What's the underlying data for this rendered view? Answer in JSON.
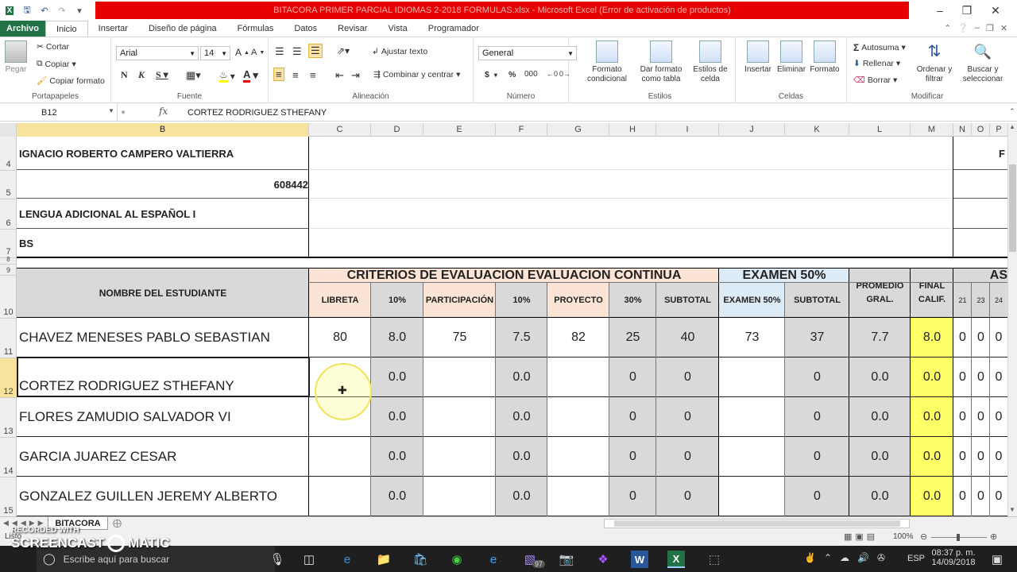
{
  "window": {
    "title": "BITACORA PRIMER PARCIAL IDIOMAS 2-2018 FORMULAS.xlsx - Microsoft Excel (Error de activación de productos)"
  },
  "tabs": [
    "Archivo",
    "Inicio",
    "Insertar",
    "Diseño de página",
    "Fórmulas",
    "Datos",
    "Revisar",
    "Vista",
    "Programador"
  ],
  "ribbon": {
    "clipboard": {
      "paste": "Pegar",
      "cut": "Cortar",
      "copy": "Copiar",
      "format_painter": "Copiar formato",
      "label": "Portapapeles"
    },
    "font": {
      "name": "Arial",
      "size": "14",
      "label": "Fuente"
    },
    "alignment": {
      "wrap": "Ajustar texto",
      "merge": "Combinar y centrar",
      "label": "Alineación"
    },
    "number": {
      "format": "General",
      "currency": "$",
      "percent": "%",
      "thousands": "000",
      "label": "Número"
    },
    "styles": {
      "cond": "Formato condicional",
      "table": "Dar formato como tabla",
      "cell": "Estilos de celda",
      "label": "Estilos"
    },
    "cells": {
      "insert": "Insertar",
      "delete": "Eliminar",
      "format": "Formato",
      "label": "Celdas"
    },
    "editing": {
      "autosum": "Autosuma",
      "fill": "Rellenar",
      "clear": "Borrar",
      "sort": "Ordenar y filtrar",
      "find": "Buscar y seleccionar",
      "label": "Modificar"
    }
  },
  "formula_bar": {
    "name_box": "B12",
    "fx": "fx",
    "content": "CORTEZ RODRIGUEZ STHEFANY"
  },
  "columns": [
    "B",
    "C",
    "D",
    "E",
    "F",
    "G",
    "H",
    "I",
    "J",
    "K",
    "L",
    "M",
    "N",
    "O",
    "P"
  ],
  "rows": [
    "4",
    "5",
    "6",
    "7",
    "8",
    "9",
    "10",
    "11",
    "12",
    "13",
    "14",
    "15"
  ],
  "header_info": {
    "teacher": "IGNACIO ROBERTO CAMPERO VALTIERRA",
    "id": "608442",
    "subject": "LENGUA ADICIONAL AL ESPAÑOL I",
    "group": "BS",
    "right_mark": "F"
  },
  "table_headers": {
    "student": "NOMBRE DEL ESTUDIANTE",
    "criteria": "CRITERIOS DE EVALUACION EVALUACION CONTINUA",
    "exam": "EXAMEN 50%",
    "avg": "PROMEDIO GRAL.",
    "final": "FINAL CALIF.",
    "attendance": "AS",
    "sub": [
      "LIBRETA",
      "10%",
      "PARTICIPACIÓN",
      "10%",
      "PROYECTO",
      "30%",
      "SUBTOTAL",
      "EXAMEN 50%",
      "SUBTOTAL"
    ],
    "days": [
      "21",
      "23",
      "24"
    ]
  },
  "students": [
    {
      "name": "CHAVEZ MENESES PABLO SEBASTIAN",
      "libreta": "80",
      "p1": "8.0",
      "part": "75",
      "p2": "7.5",
      "proy": "82",
      "p3": "25",
      "sub": "40",
      "exam": "73",
      "sub2": "37",
      "avg": "7.7",
      "final": "8.0",
      "a": [
        "0",
        "0",
        "0"
      ]
    },
    {
      "name": "CORTEZ RODRIGUEZ STHEFANY",
      "libreta": "",
      "p1": "0.0",
      "part": "",
      "p2": "0.0",
      "proy": "",
      "p3": "0",
      "sub": "0",
      "exam": "",
      "sub2": "0",
      "avg": "0.0",
      "final": "0.0",
      "a": [
        "0",
        "0",
        "0"
      ]
    },
    {
      "name": "FLORES ZAMUDIO SALVADOR VI",
      "libreta": "",
      "p1": "0.0",
      "part": "",
      "p2": "0.0",
      "proy": "",
      "p3": "0",
      "sub": "0",
      "exam": "",
      "sub2": "0",
      "avg": "0.0",
      "final": "0.0",
      "a": [
        "0",
        "0",
        "0"
      ]
    },
    {
      "name": "GARCIA JUAREZ CESAR",
      "libreta": "",
      "p1": "0.0",
      "part": "",
      "p2": "0.0",
      "proy": "",
      "p3": "0",
      "sub": "0",
      "exam": "",
      "sub2": "0",
      "avg": "0.0",
      "final": "0.0",
      "a": [
        "0",
        "0",
        "0"
      ]
    },
    {
      "name": "GONZALEZ GUILLEN JEREMY ALBERTO",
      "libreta": "",
      "p1": "0.0",
      "part": "",
      "p2": "0.0",
      "proy": "",
      "p3": "0",
      "sub": "0",
      "exam": "",
      "sub2": "0",
      "avg": "0.0",
      "final": "0.0",
      "a": [
        "0",
        "0",
        "0"
      ]
    }
  ],
  "sheet_tab": "BITACORA",
  "status": {
    "ready": "Listo",
    "zoom": "100%"
  },
  "watermark": {
    "line1": "RECORDED WITH",
    "line2": "SCREENCAST",
    "line3": "MATIC"
  },
  "taskbar": {
    "search": "Escribe aquí para buscar",
    "lang": "ESP",
    "time": "08:37 p. m.",
    "date": "14/09/2018",
    "badge": "97"
  },
  "colors": {
    "excel_green": "#217346",
    "title_red": "#e60000",
    "peach": "#fbe4d5",
    "blue": "#ddebf7",
    "yellow": "#ffff66",
    "gray": "#d9d9d9"
  }
}
